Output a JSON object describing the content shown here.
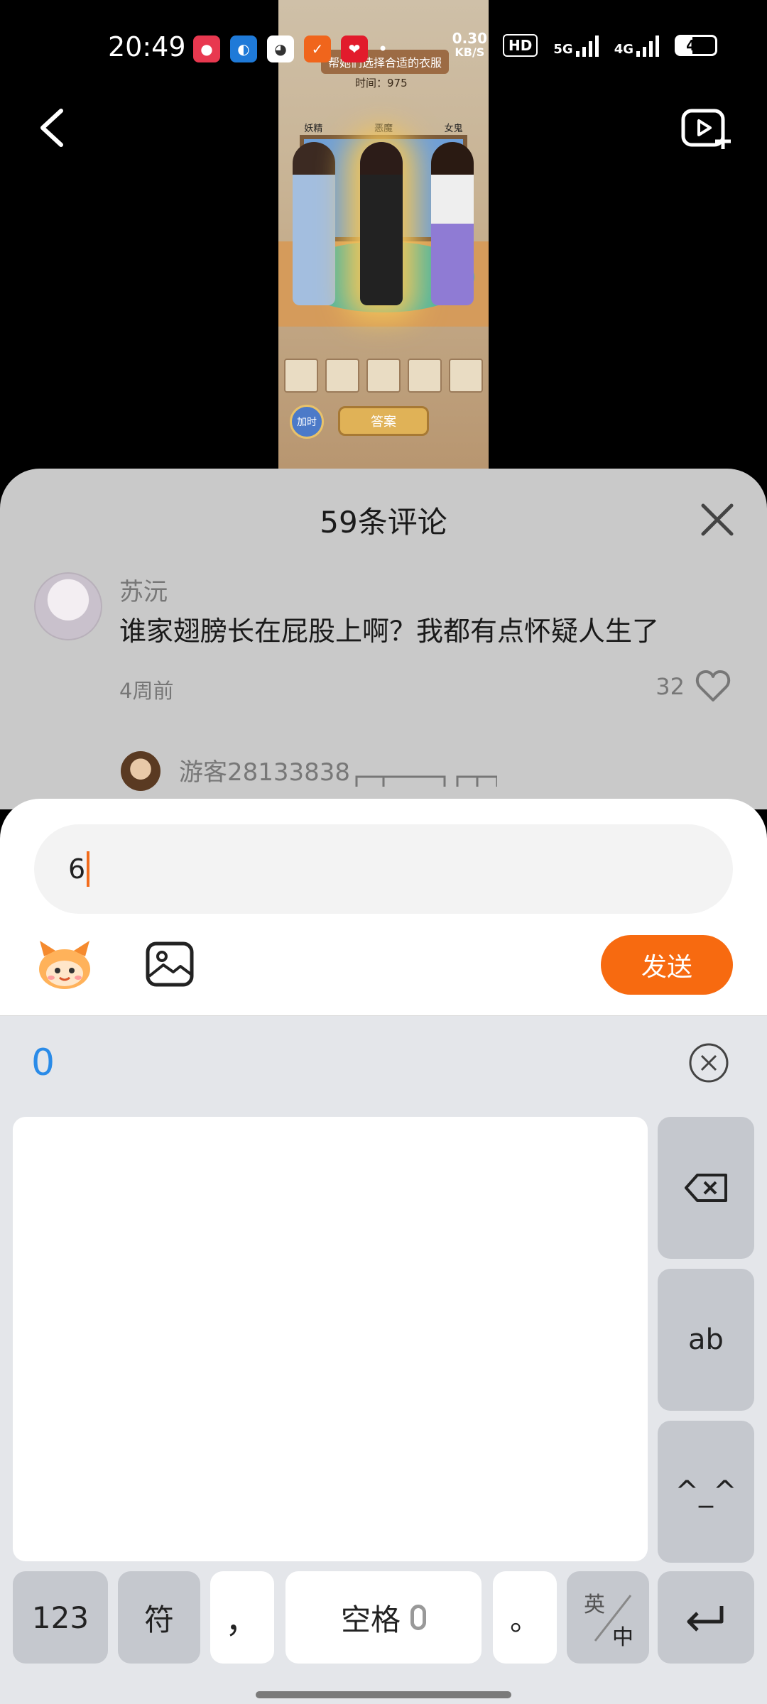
{
  "status_bar": {
    "time": "20:49",
    "net_speed_value": "0.30",
    "net_speed_unit": "KB/S",
    "hd_badge": "HD",
    "signal_5g": "5G",
    "signal_4g": "4G",
    "battery": "41"
  },
  "video": {
    "game_title": "帮她们选择合适的衣服",
    "game_timer": "时间：975",
    "labels": [
      "妖精",
      "恶魔",
      "女鬼"
    ],
    "add_time_button": "加时",
    "answer_button": "答案"
  },
  "comments": {
    "title": "59条评论",
    "items": [
      {
        "author": "苏沅",
        "text": "谁家翅膀长在屁股上啊？我都有点怀疑人生了",
        "time": "4周前",
        "likes": "32"
      }
    ],
    "reply_preview": {
      "author": "游客28133838"
    }
  },
  "input": {
    "value": "6",
    "send_label": "发送"
  },
  "keyboard": {
    "candidate": "0",
    "side_keys": {
      "ab": "ab",
      "emoticon": "^_^"
    },
    "bottom_keys": {
      "numbers": "123",
      "symbols": "符",
      "comma": "，",
      "space": "空格",
      "period": "。",
      "lang_top": "英",
      "lang_bottom": "中"
    }
  }
}
